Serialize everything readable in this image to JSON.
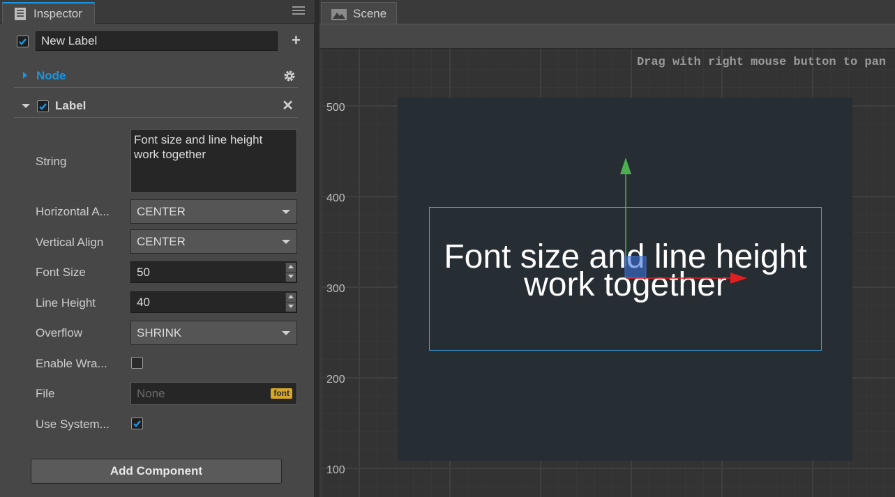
{
  "inspector": {
    "tab_title": "Inspector",
    "icon": "inspector-icon",
    "menu_icon": "hamburger-menu-icon",
    "node_name": "New Label",
    "node_enabled": true,
    "add_icon": "plus-icon",
    "node_section": {
      "title": "Node",
      "icon": "gear-icon",
      "expanded": false
    },
    "label_section": {
      "title": "Label",
      "enabled": true,
      "expanded": true,
      "remove_icon": "close-icon"
    },
    "properties": {
      "string": {
        "label": "String",
        "value": "Font size and line height\nwork together"
      },
      "horizontal_align": {
        "label": "Horizontal A...",
        "value": "CENTER"
      },
      "vertical_align": {
        "label": "Vertical Align",
        "value": "CENTER"
      },
      "font_size": {
        "label": "Font Size",
        "value": "50"
      },
      "line_height": {
        "label": "Line Height",
        "value": "40"
      },
      "overflow": {
        "label": "Overflow",
        "value": "SHRINK"
      },
      "enable_wrap": {
        "label": "Enable Wra...",
        "checked": false
      },
      "file": {
        "label": "File",
        "placeholder": "None",
        "badge": "font"
      },
      "use_system_font": {
        "label": "Use System...",
        "checked": true
      }
    },
    "add_component_label": "Add Component"
  },
  "scene": {
    "tab_title": "Scene",
    "icon": "scene-icon",
    "hint": "Drag with right mouse button to pan",
    "ruler_labels": [
      "500",
      "400",
      "300",
      "200",
      "100"
    ],
    "label_render_text": "Font size and line height\nwork together",
    "colors": {
      "selection": "#3aa3e8",
      "x_axis": "#e02020",
      "y_axis": "#4caf50",
      "accent": "#1c94e0"
    }
  }
}
